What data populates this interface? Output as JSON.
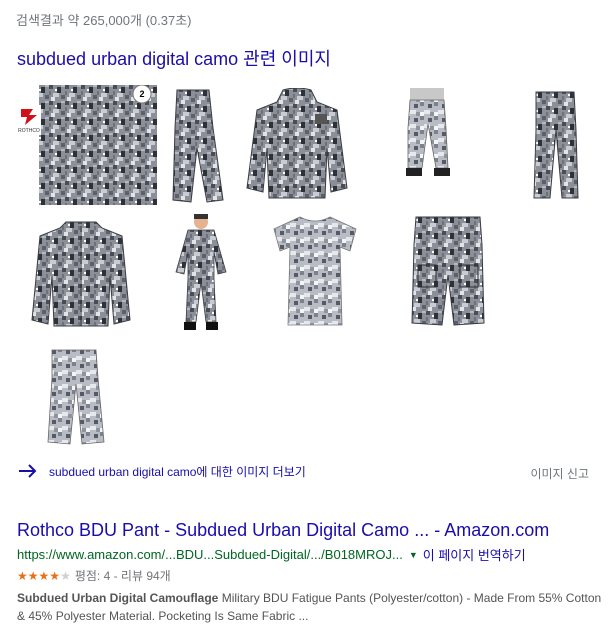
{
  "stats": "검색결과 약 265,000개 (0.37초)",
  "images_header": {
    "query": "subdued urban digital camo",
    "suffix": " 관련 이미지"
  },
  "thumbnails": [
    {
      "name": "fabric-swatch",
      "badge": "2",
      "brand": "ROTHCO"
    },
    {
      "name": "pants-side"
    },
    {
      "name": "hooded-jacket"
    },
    {
      "name": "man-wearing-pants"
    },
    {
      "name": "pants-front"
    },
    {
      "name": "bdu-shirt"
    },
    {
      "name": "child-uniform"
    },
    {
      "name": "t-shirt"
    },
    {
      "name": "cargo-shorts"
    },
    {
      "name": "bdu-pants"
    }
  ],
  "more_images": {
    "link": "subdued urban digital camo에 대한 이미지 더보기",
    "report": "이미지 신고"
  },
  "result": {
    "title": "Rothco BDU Pant - Subdued Urban Digital Camo ... - Amazon.com",
    "url": "https://www.amazon.com/...BDU...Subdued-Digital/.../B018MROJ...",
    "translate": "이 페이지 번역하기",
    "rating_value": 4,
    "rating_text": "평점: 4 - 리뷰 94개",
    "snippet_bold": "Subdued Urban Digital Camouflage",
    "snippet": " Military BDU Fatigue Pants (Polyester/cotton) - Made From 55% Cotton & 45% Polyester Material. Pocketing Is Same Fabric ..."
  },
  "colors": {
    "link": "#1a0dab",
    "url_green": "#006621",
    "star": "#e7711b",
    "gray_text": "#70757a"
  }
}
